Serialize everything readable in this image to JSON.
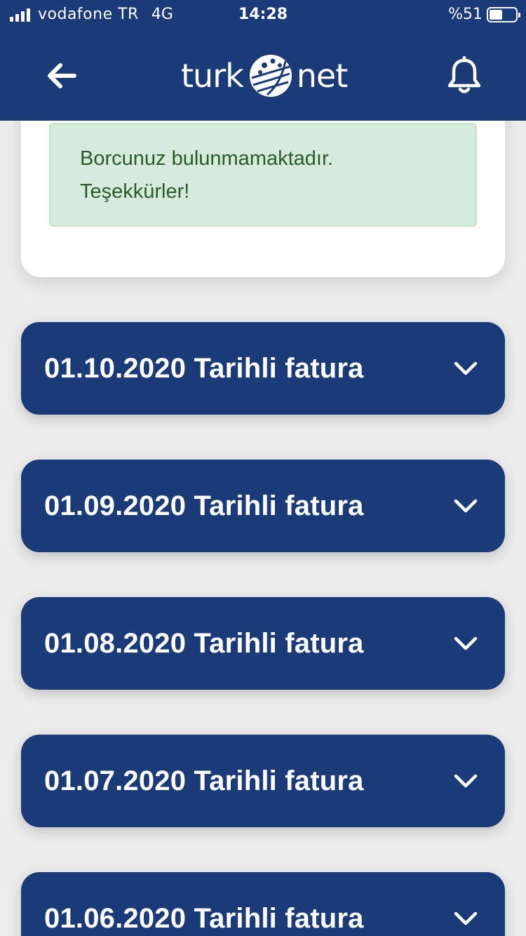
{
  "status_bar": {
    "carrier": "vodafone TR",
    "network": "4G",
    "time": "14:28",
    "battery_text": "%51",
    "battery_level": 0.51
  },
  "header": {
    "logo_left": "turk",
    "logo_right": "net",
    "back_icon": "arrow-left-icon",
    "bell_icon": "bell-icon"
  },
  "alert": {
    "line1": "Borcunuz bulunmamaktadır.",
    "line2": "Teşekkürler!"
  },
  "invoices": [
    {
      "label": "01.10.2020 Tarihli fatura"
    },
    {
      "label": "01.09.2020 Tarihli fatura"
    },
    {
      "label": "01.08.2020 Tarihli fatura"
    },
    {
      "label": "01.07.2020 Tarihli fatura"
    },
    {
      "label": "01.06.2020 Tarihli fatura"
    }
  ],
  "colors": {
    "brand": "#1b3a78",
    "background": "#ececec",
    "alert_bg": "#d6ebdb",
    "alert_text": "#295b2e"
  }
}
